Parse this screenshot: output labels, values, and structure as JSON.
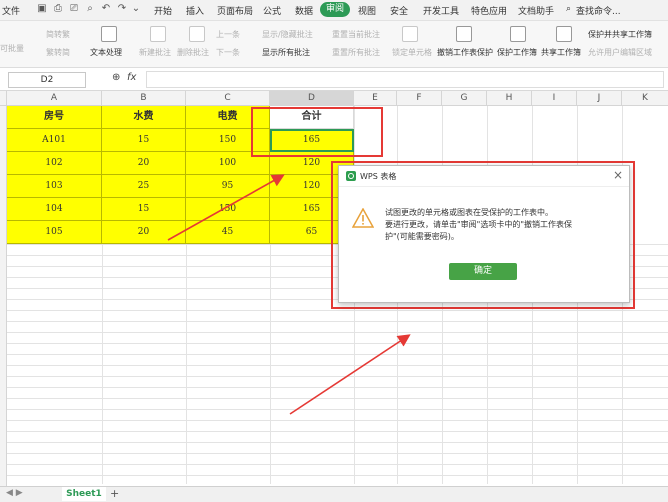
{
  "menu": {
    "file": "文件",
    "tabs": [
      "开始",
      "插入",
      "页面布局",
      "公式",
      "数据",
      "审阅",
      "视图",
      "安全",
      "开发工具",
      "特色应用",
      "文档助手"
    ],
    "active_tab": "审阅",
    "search": "查找命令..."
  },
  "toolbar": {
    "item_1": "可批量",
    "item_2": "简转繁",
    "item_3": "繁转简",
    "text_process": "文本处理",
    "new_comment": "新建批注",
    "delete_comment": "删除批注",
    "prev": "上一条",
    "next": "下一条",
    "show_hide_comment": "显示/隐藏批注",
    "show_all_comments": "显示所有批注",
    "reset_current_comment": "重置当前批注",
    "reset_all_comments": "重置所有批注",
    "lock_cell": "锁定单元格",
    "unprotect_sheet": "撤销工作表保护",
    "protect_workbook": "保护工作簿",
    "share_workbook": "共享工作簿",
    "protect_share_workbook": "保护并共享工作簿",
    "allow_edit_ranges": "允许用户编辑区域"
  },
  "formula_bar": {
    "name_box": "D2",
    "fx": "fx"
  },
  "columns": [
    "A",
    "B",
    "C",
    "D",
    "E",
    "F",
    "G",
    "H",
    "I",
    "J",
    "K"
  ],
  "table": {
    "headers": [
      "房号",
      "水费",
      "电费",
      "合计"
    ],
    "rows": [
      [
        "A101",
        "15",
        "150",
        "165"
      ],
      [
        "102",
        "20",
        "100",
        "120"
      ],
      [
        "103",
        "25",
        "95",
        "120"
      ],
      [
        "104",
        "15",
        "150",
        "165"
      ],
      [
        "105",
        "20",
        "45",
        "65"
      ]
    ]
  },
  "dialog": {
    "title": "WPS 表格",
    "line1": "试图更改的单元格或图表在受保护的工作表中。",
    "line2": "要进行更改，请单击\"审阅\"选项卡中的\"撤销工作表保",
    "line3": "护\"(可能需要密码)。",
    "ok": "确定"
  },
  "sheet": {
    "tab": "Sheet1",
    "add": "+"
  },
  "colors": {
    "accent": "#2d9a56",
    "highlight": "#ffff00",
    "annotation": "#e53935",
    "ok_button": "#47a346"
  }
}
